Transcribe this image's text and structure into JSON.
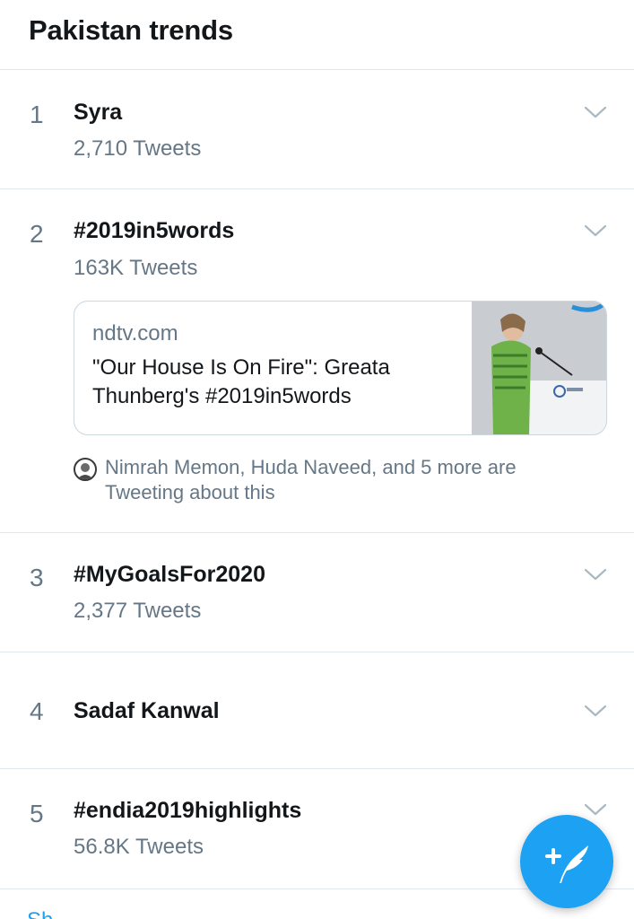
{
  "header": {
    "title": "Pakistan trends"
  },
  "trends": [
    {
      "rank": "1",
      "name": "Syra",
      "count": "2,710 Tweets"
    },
    {
      "rank": "2",
      "name": "#2019in5words",
      "count": "163K Tweets",
      "card": {
        "domain": "ndtv.com",
        "title": "\"Our House Is On Fire\": Greata Thunberg's #2019in5words"
      },
      "social": "Nimrah Memon, Huda Naveed, and 5 more are Tweeting about this"
    },
    {
      "rank": "3",
      "name": "#MyGoalsFor2020",
      "count": "2,377 Tweets"
    },
    {
      "rank": "4",
      "name": "Sadaf Kanwal"
    },
    {
      "rank": "5",
      "name": "#endia2019highlights",
      "count": "56.8K Tweets"
    }
  ],
  "footer": {
    "show_more": "Sh"
  },
  "colors": {
    "accent": "#1da1f2",
    "secondary_text": "#657786",
    "divider": "#e1e8ed"
  },
  "icons": {
    "chevron": "chevron-down-icon",
    "compose": "compose-tweet-icon",
    "avatar": "user-avatar"
  }
}
